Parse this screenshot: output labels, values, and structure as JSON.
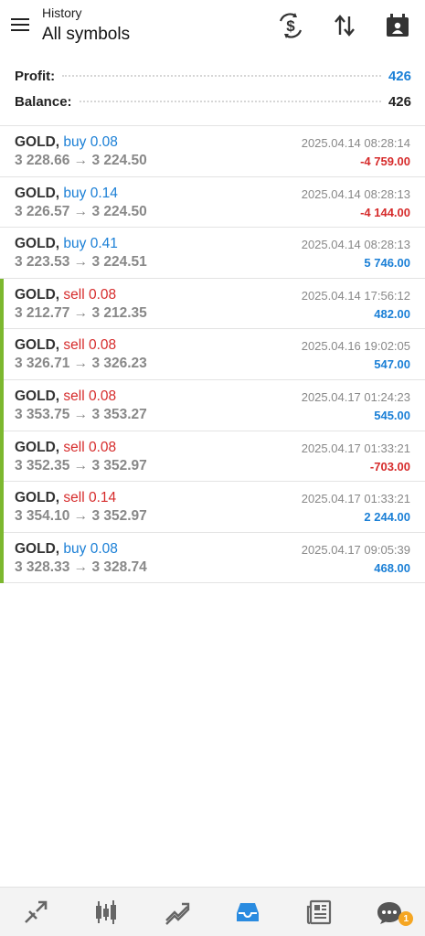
{
  "header": {
    "subtitle": "History",
    "title": "All symbols"
  },
  "summary": {
    "profit_label": "Profit:",
    "profit_value": "426",
    "balance_label": "Balance:",
    "balance_value": "426"
  },
  "colors": {
    "buy": "#1a7fd6",
    "sell": "#d62b2b",
    "profit_positive": "#1a7fd6",
    "profit_negative": "#d62b2b",
    "accent_bar": "#7cb82f",
    "nav_active": "#2a8be0"
  },
  "deals": [
    {
      "symbol": "GOLD,",
      "action": "buy 0.08",
      "type": "buy",
      "prices": "3 228.66 → 3 224.50",
      "time": "2025.04.14 08:28:14",
      "profit": "-4 759.00",
      "positive": false,
      "accent": false
    },
    {
      "symbol": "GOLD,",
      "action": "buy 0.14",
      "type": "buy",
      "prices": "3 226.57 → 3 224.50",
      "time": "2025.04.14 08:28:13",
      "profit": "-4 144.00",
      "positive": false,
      "accent": false
    },
    {
      "symbol": "GOLD,",
      "action": "buy 0.41",
      "type": "buy",
      "prices": "3 223.53 → 3 224.51",
      "time": "2025.04.14 08:28:13",
      "profit": "5 746.00",
      "positive": true,
      "accent": false
    },
    {
      "symbol": "GOLD,",
      "action": "sell 0.08",
      "type": "sell",
      "prices": "3 212.77 → 3 212.35",
      "time": "2025.04.14 17:56:12",
      "profit": "482.00",
      "positive": true,
      "accent": true
    },
    {
      "symbol": "GOLD,",
      "action": "sell 0.08",
      "type": "sell",
      "prices": "3 326.71 → 3 326.23",
      "time": "2025.04.16 19:02:05",
      "profit": "547.00",
      "positive": true,
      "accent": true
    },
    {
      "symbol": "GOLD,",
      "action": "sell 0.08",
      "type": "sell",
      "prices": "3 353.75 → 3 353.27",
      "time": "2025.04.17 01:24:23",
      "profit": "545.00",
      "positive": true,
      "accent": true
    },
    {
      "symbol": "GOLD,",
      "action": "sell 0.08",
      "type": "sell",
      "prices": "3 352.35 → 3 352.97",
      "time": "2025.04.17 01:33:21",
      "profit": "-703.00",
      "positive": false,
      "accent": true
    },
    {
      "symbol": "GOLD,",
      "action": "sell 0.14",
      "type": "sell",
      "prices": "3 354.10 → 3 352.97",
      "time": "2025.04.17 01:33:21",
      "profit": "2 244.00",
      "positive": true,
      "accent": true
    },
    {
      "symbol": "GOLD,",
      "action": "buy 0.08",
      "type": "buy",
      "prices": "3 328.33 → 3 328.74",
      "time": "2025.04.17 09:05:39",
      "profit": "468.00",
      "positive": true,
      "accent": true
    }
  ],
  "toolbar_icons": [
    "currency-exchange-icon",
    "sort-icon",
    "calendar-icon"
  ],
  "bottom_nav": {
    "items": [
      "quotes-icon",
      "chart-icon",
      "trade-icon",
      "history-icon",
      "news-icon",
      "messages-icon"
    ],
    "active": "history-icon",
    "messages_badge": "1"
  }
}
